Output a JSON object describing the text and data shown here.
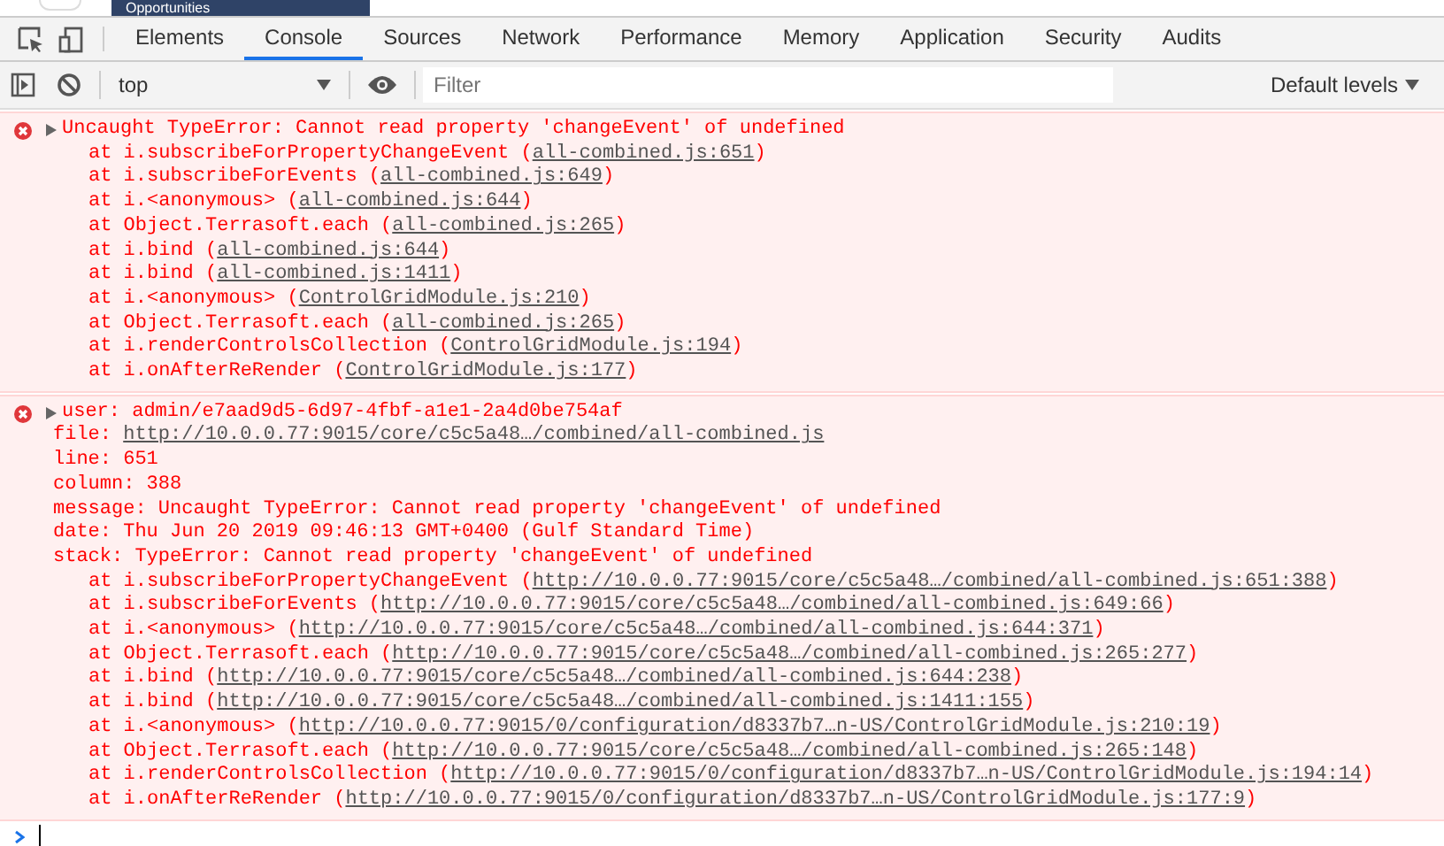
{
  "page_header": {
    "title": "Opportunities"
  },
  "tabs": [
    {
      "label": "Elements",
      "selected": false
    },
    {
      "label": "Console",
      "selected": true
    },
    {
      "label": "Sources",
      "selected": false
    },
    {
      "label": "Network",
      "selected": false
    },
    {
      "label": "Performance",
      "selected": false
    },
    {
      "label": "Memory",
      "selected": false
    },
    {
      "label": "Application",
      "selected": false
    },
    {
      "label": "Security",
      "selected": false
    },
    {
      "label": "Audits",
      "selected": false
    }
  ],
  "toolbar": {
    "context": "top",
    "filter": {
      "placeholder": "Filter"
    },
    "levels": "Default levels"
  },
  "messages": [
    {
      "kind": "error",
      "expanded": false,
      "text": "Uncaught TypeError: Cannot read property 'changeEvent' of undefined",
      "lines": [
        {
          "text": "at i.subscribeForPropertyChangeEvent (",
          "link": "all-combined.js:651",
          "end": ")"
        },
        {
          "text": "at i.subscribeForEvents (",
          "link": "all-combined.js:649",
          "end": ")"
        },
        {
          "text": "at i.<anonymous> (",
          "link": "all-combined.js:644",
          "end": ")"
        },
        {
          "text": "at Object.Terrasoft.each (",
          "link": "all-combined.js:265",
          "end": ")"
        },
        {
          "text": "at i.bind (",
          "link": "all-combined.js:644",
          "end": ")"
        },
        {
          "text": "at i.bind (",
          "link": "all-combined.js:1411",
          "end": ")"
        },
        {
          "text": "at i.<anonymous> (",
          "link": "ControlGridModule.js:210",
          "end": ")"
        },
        {
          "text": "at Object.Terrasoft.each (",
          "link": "all-combined.js:265",
          "end": ")"
        },
        {
          "text": "at i.renderControlsCollection (",
          "link": "ControlGridModule.js:194",
          "end": ")"
        },
        {
          "text": "at i.onAfterReRender (",
          "link": "ControlGridModule.js:177",
          "end": ")"
        }
      ]
    },
    {
      "kind": "error",
      "expanded": false,
      "text": "user: admin/e7aad9d5-6d97-4fbf-a1e1-2a4d0be754af",
      "lines": [
        {
          "text": "file: ",
          "link": "http://10.0.0.77:9015/core/c5c5a48…/combined/all-combined.js"
        },
        {
          "text": "line: 651"
        },
        {
          "text": "column: 388"
        },
        {
          "text": "message: Uncaught TypeError: Cannot read property 'changeEvent' of undefined"
        },
        {
          "text": "date: Thu Jun 20 2019 09:46:13 GMT+0400 (Gulf Standard Time)"
        },
        {
          "text": "stack: TypeError: Cannot read property 'changeEvent' of undefined",
          "children": [
            {
              "text": "at i.subscribeForPropertyChangeEvent (",
              "link": "http://10.0.0.77:9015/core/c5c5a48…/combined/all-combined.js:651:388",
              "end": ")"
            },
            {
              "text": "at i.subscribeForEvents (",
              "link": "http://10.0.0.77:9015/core/c5c5a48…/combined/all-combined.js:649:66",
              "end": ")"
            },
            {
              "text": "at i.<anonymous> (",
              "link": "http://10.0.0.77:9015/core/c5c5a48…/combined/all-combined.js:644:371",
              "end": ")"
            },
            {
              "text": "at Object.Terrasoft.each (",
              "link": "http://10.0.0.77:9015/core/c5c5a48…/combined/all-combined.js:265:277",
              "end": ")"
            },
            {
              "text": "at i.bind (",
              "link": "http://10.0.0.77:9015/core/c5c5a48…/combined/all-combined.js:644:238",
              "end": ")"
            },
            {
              "text": "at i.bind (",
              "link": "http://10.0.0.77:9015/core/c5c5a48…/combined/all-combined.js:1411:155",
              "end": ")"
            },
            {
              "text": "at i.<anonymous> (",
              "link": "http://10.0.0.77:9015/0/configuration/d8337b7…n-US/ControlGridModule.js:210:19",
              "end": ")"
            },
            {
              "text": "at Object.Terrasoft.each (",
              "link": "http://10.0.0.77:9015/core/c5c5a48…/combined/all-combined.js:265:148",
              "end": ")"
            },
            {
              "text": "at i.renderControlsCollection (",
              "link": "http://10.0.0.77:9015/0/configuration/d8337b7…n-US/ControlGridModule.js:194:14",
              "end": ")"
            },
            {
              "text": "at i.onAfterReRender (",
              "link": "http://10.0.0.77:9015/0/configuration/d8337b7…n-US/ControlGridModule.js:177:9",
              "end": ")"
            }
          ]
        }
      ]
    }
  ]
}
